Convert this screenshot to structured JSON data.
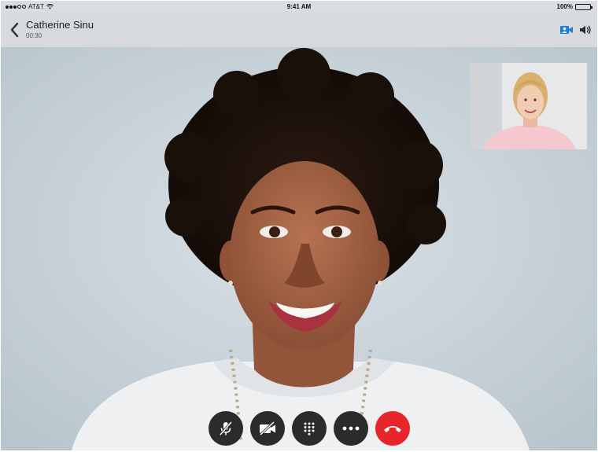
{
  "status_bar": {
    "carrier": "AT&T",
    "time": "9:41 AM",
    "battery": "100%"
  },
  "call": {
    "contact_name": "Catherine Sinu",
    "duration": "00:30"
  },
  "icons": {
    "back": "chevron-left-icon",
    "video_switch": "video-person-icon",
    "speaker": "speaker-icon",
    "mute": "microphone-muted-icon",
    "video_off": "video-off-icon",
    "keypad": "keypad-icon",
    "more": "more-icon",
    "end_call": "end-call-icon"
  },
  "colors": {
    "accent": "#1b7ed8",
    "end_call": "#e8252b",
    "control_bg": "#2b2b2d"
  }
}
